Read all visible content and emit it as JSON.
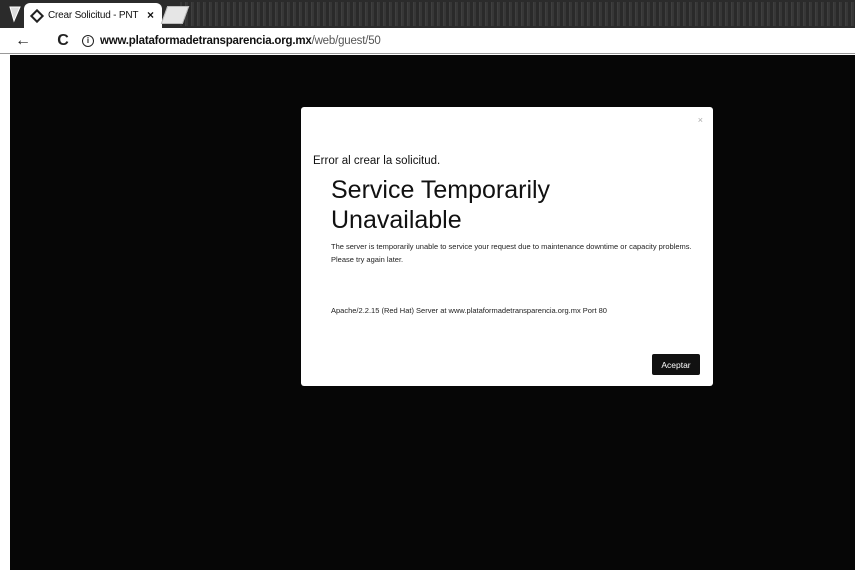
{
  "browser": {
    "tab": {
      "title": "Crear Solicitud - PNT",
      "close": "×"
    },
    "toolbar": {
      "back": "←",
      "reload": "C",
      "info": "i",
      "url_host": "www.plataformadetransparencia.org.mx",
      "url_path": "/web/guest/50"
    }
  },
  "modal": {
    "close": "×",
    "heading": "Error al crear la solicitud.",
    "title": "Service Temporarily Unavailable",
    "body": "The server is temporarily unable to service your request due to maintenance downtime or capacity problems. Please try again later.",
    "address": "Apache/2.2.15 (Red Hat) Server at www.plataformadetransparencia.org.mx Port 80",
    "accept_label": "Aceptar"
  },
  "colors": {
    "overlay": "#060606",
    "button": "#111111",
    "modal_bg": "#ffffff"
  }
}
